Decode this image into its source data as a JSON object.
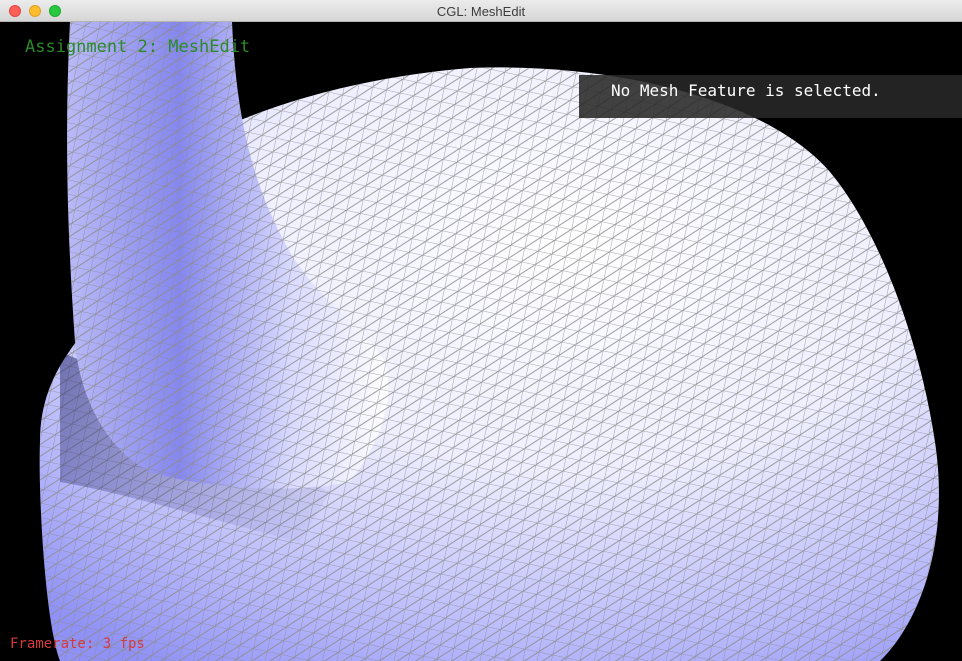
{
  "window": {
    "title": "CGL: MeshEdit",
    "controls": [
      "close-button",
      "minimize-button",
      "zoom-button"
    ]
  },
  "viewport": {
    "app_label": "Assignment 2: MeshEdit",
    "status_message": "No Mesh Feature is selected.",
    "framerate_label": "Framerate: 3 fps"
  },
  "colors": {
    "background": "#000000",
    "mesh_fill_light": "#ffffff",
    "mesh_fill_shade": "#8a8cf5",
    "wireframe": "#8c8c8c",
    "app_label": "#2a8a2a",
    "framerate_label": "#d43a3a",
    "status_text": "#ffffff"
  }
}
